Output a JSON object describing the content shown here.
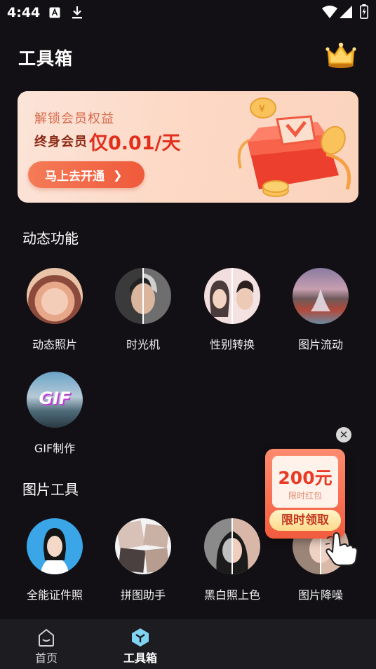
{
  "status_bar": {
    "time": "4:44"
  },
  "header": {
    "title": "工具箱"
  },
  "banner": {
    "line1": "解锁会员权益",
    "line2_prefix": "终身会员",
    "price": "仅0.01/天",
    "button_label": "马上去开通"
  },
  "sections": [
    {
      "title": "动态功能",
      "items": [
        {
          "label": "动态照片",
          "icon": "portrait-girl-thumbnail"
        },
        {
          "label": "时光机",
          "icon": "age-compare-thumbnail"
        },
        {
          "label": "性别转换",
          "icon": "gender-swap-thumbnail"
        },
        {
          "label": "图片流动",
          "icon": "waterfall-thumbnail"
        },
        {
          "label": "GIF制作",
          "icon": "gif-thumbnail",
          "badge": "GIF"
        }
      ]
    },
    {
      "title": "图片工具",
      "items": [
        {
          "label": "全能证件照",
          "icon": "id-photo-thumbnail"
        },
        {
          "label": "拼图助手",
          "icon": "collage-thumbnail"
        },
        {
          "label": "黑白照上色",
          "icon": "colorize-thumbnail"
        },
        {
          "label": "图片降噪",
          "icon": "denoise-thumbnail"
        }
      ]
    }
  ],
  "floating_promo": {
    "amount": "200元",
    "subtitle": "限时红包",
    "button_label": "限时领取",
    "close_symbol": "✕"
  },
  "tab_bar": {
    "tabs": [
      {
        "label": "首页",
        "icon": "home-icon",
        "active": false
      },
      {
        "label": "工具箱",
        "icon": "toolbox-icon",
        "active": true
      }
    ]
  },
  "colors": {
    "background": "#121014",
    "accent_red": "#e22f1c",
    "banner_bg": "#fcdcca",
    "tab_active_icon": "#7fd4f2"
  }
}
